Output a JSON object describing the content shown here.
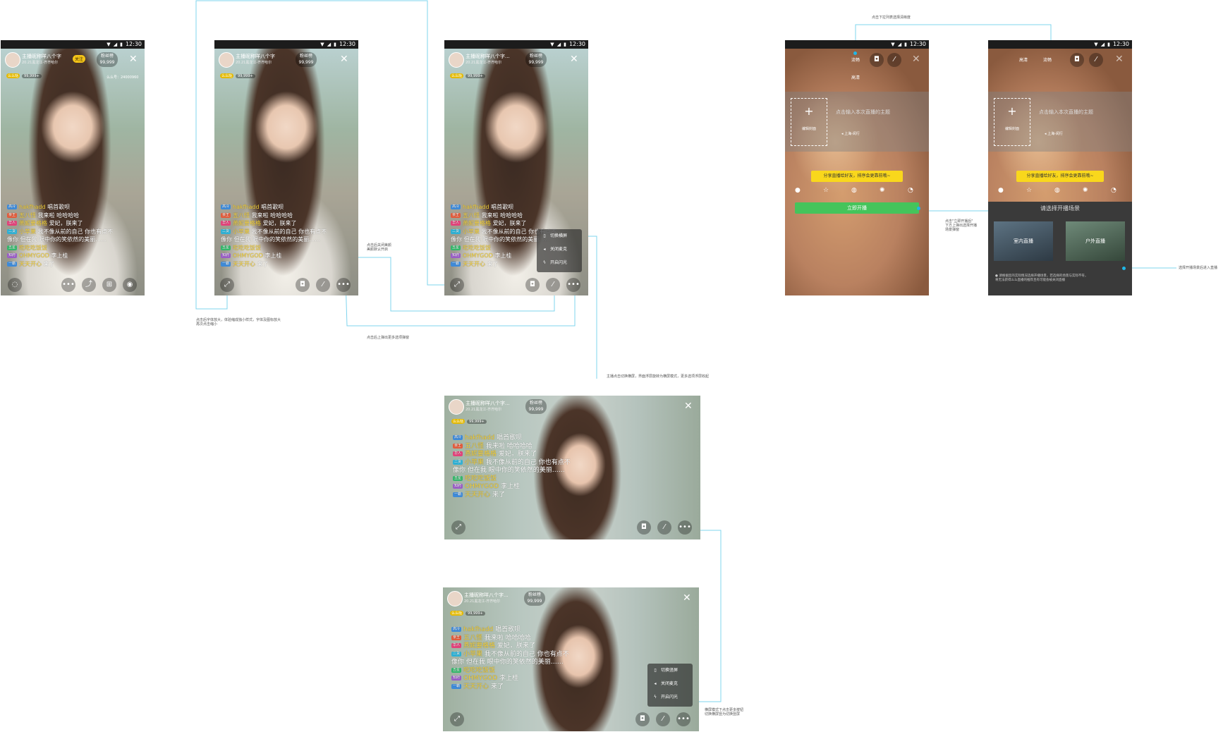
{
  "status": {
    "time": "12:30"
  },
  "anchor": {
    "name": "主播昵称咩八个字",
    "name_short": "主播昵称咩八个字...",
    "sub": "20.21黑龙江-齐齐哈尔",
    "follow": "关注",
    "fans_label": "粉丝榜",
    "fans_count": "99,999",
    "level": "么么哒",
    "level_count": "99,999+",
    "room_id": "么么号：24000960"
  },
  "chat": [
    {
      "tag": "高冷",
      "color": "t-blue",
      "name": "hakfhadd",
      "text": "唱首歌呗"
    },
    {
      "tag": "亲王",
      "color": "t-red",
      "name": "五八怪",
      "text": "我来啦 哈哈哈哈"
    },
    {
      "tag": "华人",
      "color": "t-pink",
      "name": "燕妮要格格",
      "text": "爱妃，朕来了"
    },
    {
      "tag": "二货",
      "color": "t-cyan",
      "name": "小苹果",
      "text": "我不像从前的自己 你也有点不"
    },
    {
      "tag": "",
      "color": "",
      "name": "",
      "text": "像你 但在我 眼中你的笑依然的美丽……"
    },
    {
      "tag": "五星",
      "color": "t-green",
      "name": "吃吃吃饭饭",
      "text": ""
    },
    {
      "tag": "知府",
      "color": "t-purple",
      "name": "OHMYGOD",
      "text": "李上桂"
    },
    {
      "tag": "一霸",
      "color": "t-blue",
      "name": "天天开心",
      "text": "来了"
    }
  ],
  "menu": {
    "item1": "切换横屏",
    "item1_alt": "切换竖屏",
    "item2": "关闭麦克",
    "item3": "开启闪光"
  },
  "notes": {
    "zoom": "点击后字体放大，体验缩成独小样式，字体及图标放大\n再次点击缩小",
    "beauty": "点击后关闭美颜\n美颜默认开启",
    "more": "点击后上弹出更多选项弹窗",
    "landscape": "主播点击切换横屏，界面浮层旋转为横屏模式，更多选项浮层收起",
    "quality": "点击下拉列表选择清晰度",
    "start": "点击\"立即开播后\"\n下方上弹出选择开播\n场景弹窗",
    "scene": "选择开播场景后进入直播",
    "land_more": "横屏模式下点击更多按钮\n切换横屏竖为切换竖屏"
  },
  "prelive": {
    "quality_fluent": "流畅",
    "quality_hd": "高清",
    "cover_label": "编辑封面",
    "title_placeholder": "点击输入本次直播的主题",
    "location": "上海-闵行",
    "share_tip": "分享直播给好友，排序会更靠前哦~",
    "start_button": "立即开播",
    "scene_title": "请选择开播场景",
    "scene_indoor": "室内直播",
    "scene_outdoor": "户外直播",
    "scene_note": "● 请根据您的实际情况选择开播场景，若选择的场景与实际不符，\n将无法获得么么直播的推荐且有可能会被关闭直播"
  }
}
